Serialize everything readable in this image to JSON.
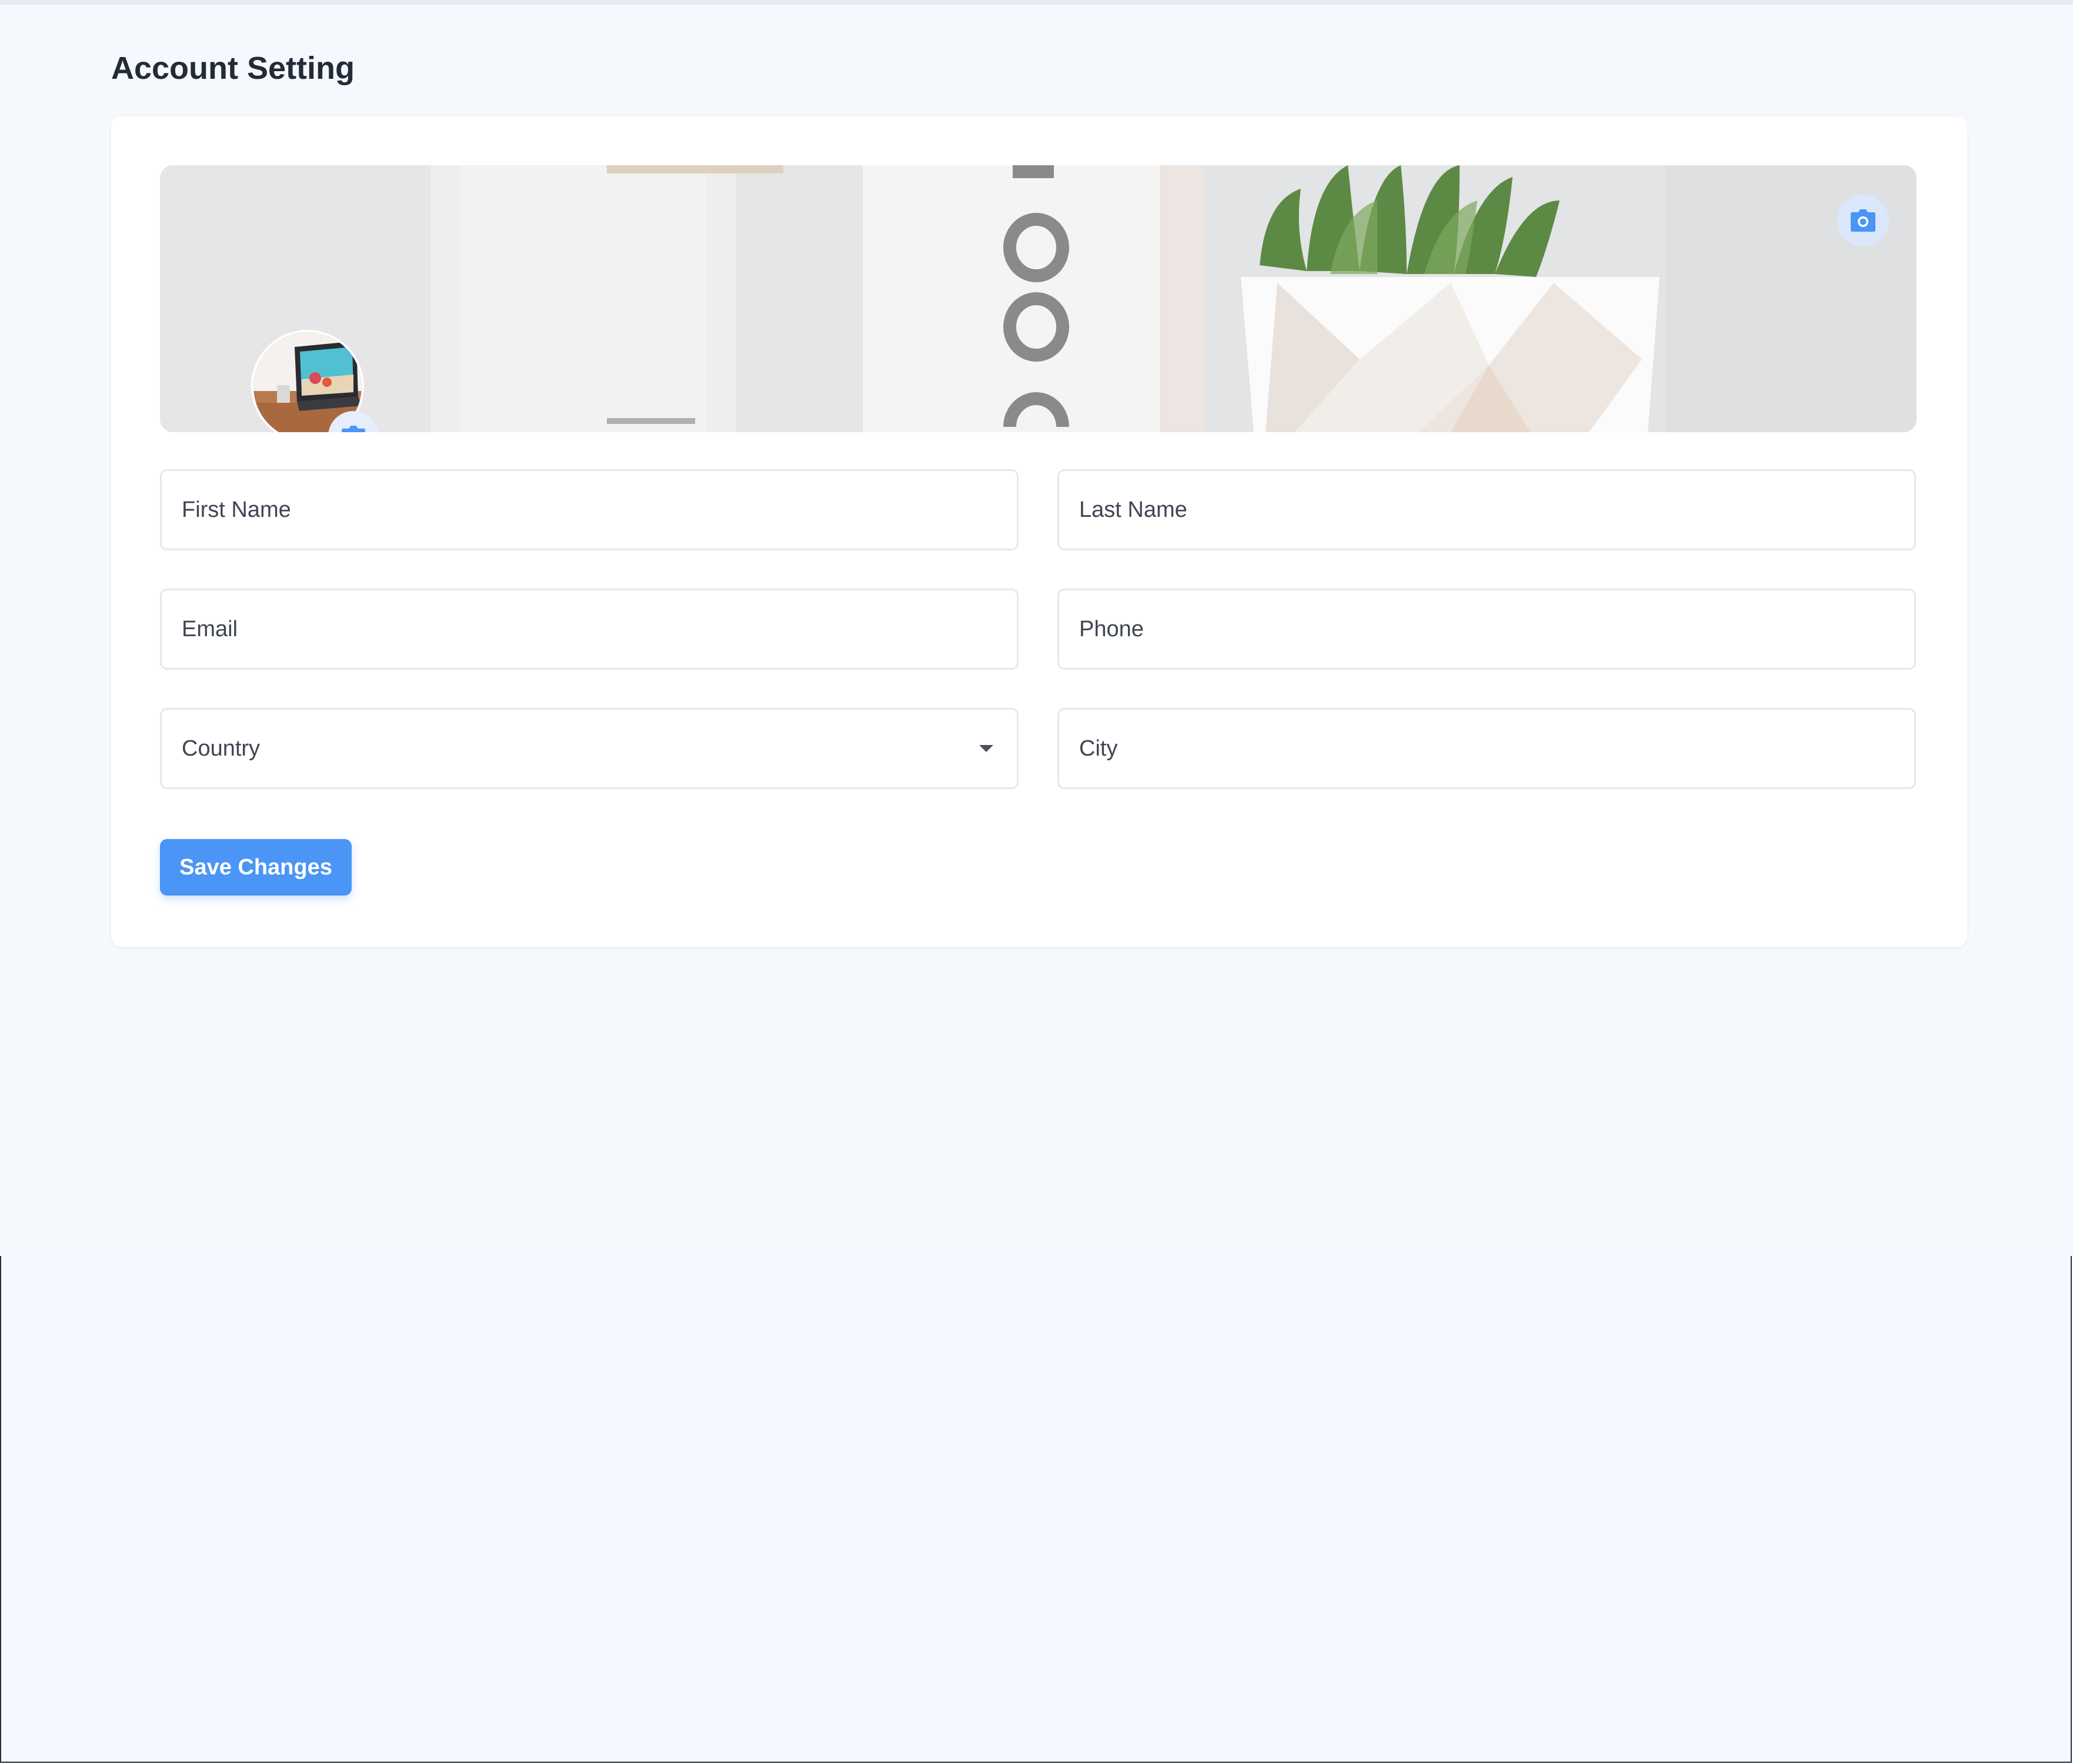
{
  "page": {
    "title": "Account Setting"
  },
  "profile": {
    "cover_icon": "camera-icon",
    "avatar_icon": "camera-icon"
  },
  "form": {
    "first_name": {
      "placeholder": "First Name",
      "value": ""
    },
    "last_name": {
      "placeholder": "Last Name",
      "value": ""
    },
    "email": {
      "placeholder": "Email",
      "value": ""
    },
    "phone": {
      "placeholder": "Phone",
      "value": ""
    },
    "country": {
      "selected": "Country",
      "options": [
        "Country"
      ]
    },
    "city": {
      "placeholder": "City",
      "value": ""
    }
  },
  "actions": {
    "save_label": "Save Changes"
  },
  "colors": {
    "accent": "#4a95f5",
    "page_background": "#f5f8fc",
    "card_background": "#ffffff",
    "title_text": "#232a38"
  }
}
